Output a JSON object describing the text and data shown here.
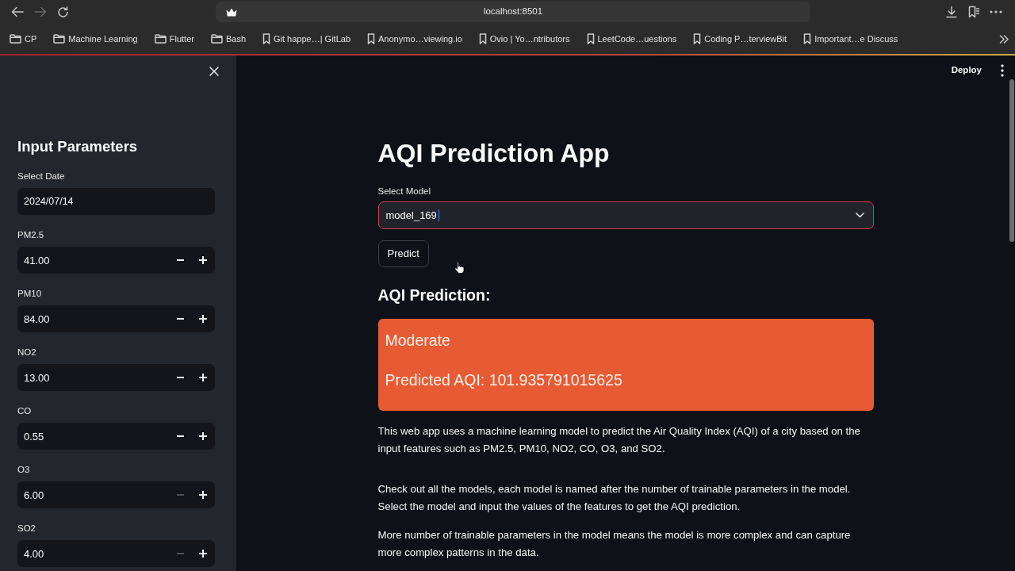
{
  "browser": {
    "back": {
      "disabled": false
    },
    "forward": {
      "disabled": true
    },
    "url": "localhost:8501",
    "bookmarks": [
      {
        "kind": "folder",
        "label": "CP"
      },
      {
        "kind": "folder",
        "label": "Machine Learning"
      },
      {
        "kind": "folder",
        "label": "Flutter"
      },
      {
        "kind": "folder",
        "label": "Bash"
      },
      {
        "kind": "bookmark",
        "label": "Git happe…| GitLab"
      },
      {
        "kind": "bookmark",
        "label": "Anonymo…viewing.io"
      },
      {
        "kind": "bookmark",
        "label": "Ovio | Yo…ntributors"
      },
      {
        "kind": "bookmark",
        "label": "LeetCode…uestions"
      },
      {
        "kind": "bookmark",
        "label": "Coding P…terviewBit"
      },
      {
        "kind": "bookmark",
        "label": "Important…e Discuss"
      }
    ]
  },
  "sidebar": {
    "title": "Input Parameters",
    "date": {
      "label": "Select Date",
      "value": "2024/07/14"
    },
    "inputs": [
      {
        "label": "PM2.5",
        "value": "41.00",
        "minus_disabled": false
      },
      {
        "label": "PM10",
        "value": "84.00",
        "minus_disabled": false
      },
      {
        "label": "NO2",
        "value": "13.00",
        "minus_disabled": false
      },
      {
        "label": "CO",
        "value": "0.55",
        "minus_disabled": false
      },
      {
        "label": "O3",
        "value": "6.00",
        "minus_disabled": true
      },
      {
        "label": "SO2",
        "value": "4.00",
        "minus_disabled": true
      }
    ]
  },
  "header": {
    "deploy": "Deploy"
  },
  "main": {
    "title": "AQI Prediction App",
    "model_select": {
      "label": "Select Model",
      "value": "model_169",
      "focused": true
    },
    "predict_button": "Predict",
    "result_heading": "AQI Prediction:",
    "result": {
      "category": "Moderate",
      "text": "Predicted AQI: 101.935791015625"
    },
    "paragraphs": [
      "This web app uses a machine learning model to predict the Air Quality Index (AQI) of a city based on the input features such as PM2.5, PM10, NO2, CO, O3, and SO2.",
      "Check out all the models, each model is named after the number of trainable parameters in the model. Select the model and input the values of the features to get the AQI prediction.",
      "More number of trainable parameters in the model means the model is more complex and can capture more complex patterns in the data."
    ]
  }
}
